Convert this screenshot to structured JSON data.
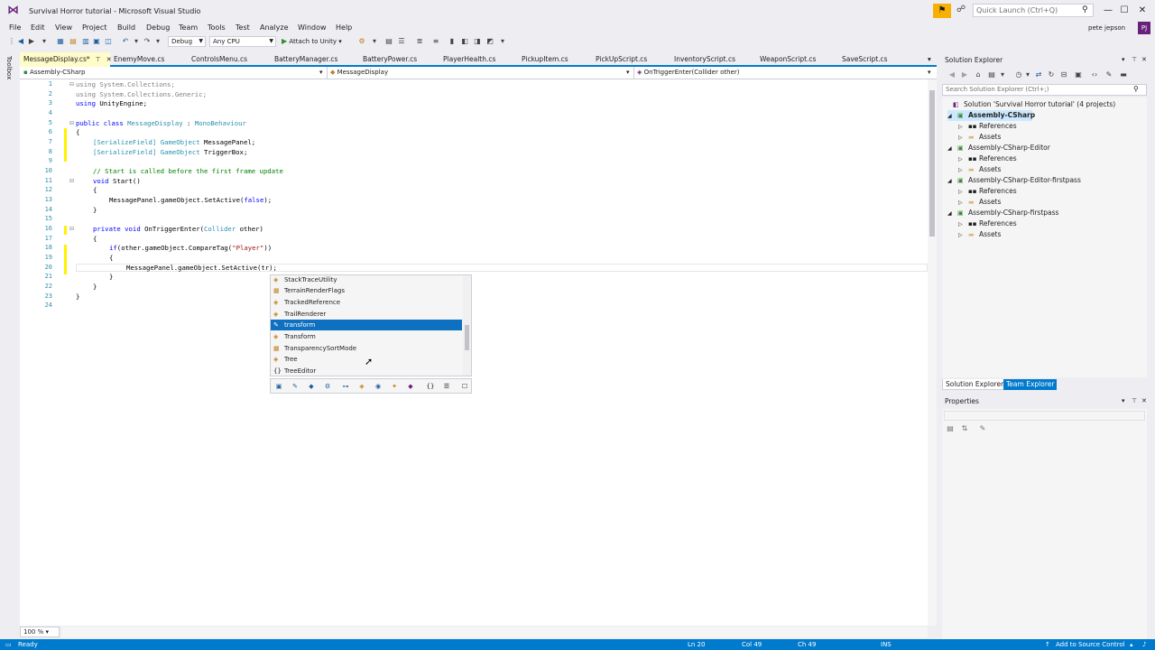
{
  "window": {
    "title": "Survival Horror tutorial - Microsoft Visual Studio",
    "quick_launch_placeholder": "Quick Launch (Ctrl+Q)",
    "user_name": "pete jepson",
    "user_initials": "PJ"
  },
  "menu": [
    "File",
    "Edit",
    "View",
    "Project",
    "Build",
    "Debug",
    "Team",
    "Tools",
    "Test",
    "Analyze",
    "Window",
    "Help"
  ],
  "toolbar": {
    "config": "Debug",
    "platform": "Any CPU",
    "attach": "Attach to Unity"
  },
  "toolbox_label": "Toolbox",
  "tabs": [
    {
      "label": "MessageDisplay.cs*",
      "active": true
    },
    {
      "label": "EnemyMove.cs"
    },
    {
      "label": "ControlsMenu.cs"
    },
    {
      "label": "BatteryManager.cs"
    },
    {
      "label": "BatteryPower.cs"
    },
    {
      "label": "PlayerHealth.cs"
    },
    {
      "label": "PickupItem.cs"
    },
    {
      "label": "PickUpScript.cs"
    },
    {
      "label": "InventoryScript.cs"
    },
    {
      "label": "WeaponScript.cs"
    },
    {
      "label": "SaveScript.cs"
    }
  ],
  "navbar": {
    "project": "Assembly-CSharp",
    "class": "MessageDisplay",
    "member": "OnTriggerEnter(Collider other)"
  },
  "code": {
    "line_numbers": [
      "1",
      "2",
      "3",
      "4",
      "5",
      "6",
      "7",
      "8",
      "9",
      "10",
      "11",
      "12",
      "13",
      "14",
      "15",
      "16",
      "17",
      "18",
      "19",
      "20",
      "21",
      "22",
      "23",
      "24"
    ],
    "using1": "using System.Collections;",
    "using2": "using System.Collections.Generic;",
    "using3_kw": "using",
    "using3_ns": " UnityEngine;",
    "class_kw": "public class ",
    "class_name": "MessageDisplay",
    "class_colon": " : ",
    "class_base": "MonoBehaviour",
    "brace_open": "{",
    "brace_close": "}",
    "sf1_attr": "[SerializeField]",
    "sf1_type": " GameObject",
    "sf1_name": " MessagePanel;",
    "sf2_attr": "[SerializeField]",
    "sf2_type": " GameObject",
    "sf2_name": " TriggerBox;",
    "comment": "// Start is called before the first frame update",
    "start_kw": "void",
    "start_name": " Start()",
    "start_open": "{",
    "start_body": "MessagePanel.gameObject.SetActive(",
    "start_false": "false",
    "start_end": ");",
    "start_close": "}",
    "ote_kw": "private void",
    "ote_name": " OnTriggerEnter(",
    "ote_type": "Collider",
    "ote_param": " other)",
    "ote_open": "{",
    "if_kw": "if",
    "if_body": "(other.gameObject.CompareTag(",
    "if_str": "\"Player\"",
    "if_end": "))",
    "if_open": "{",
    "set_body": "MessagePanel.gameObject.SetActive(tr);",
    "if_close": "}",
    "ote_close": "}",
    "class_close": "}"
  },
  "zoom": "100 %",
  "intellisense": {
    "items": [
      {
        "label": "StackTraceUtility",
        "icon": "class-icon"
      },
      {
        "label": "TerrainRenderFlags",
        "icon": "enum-icon"
      },
      {
        "label": "TrackedReference",
        "icon": "class-icon"
      },
      {
        "label": "TrailRenderer",
        "icon": "class-icon"
      },
      {
        "label": "transform",
        "icon": "property-icon",
        "selected": true
      },
      {
        "label": "Transform",
        "icon": "class-icon"
      },
      {
        "label": "TransparencySortMode",
        "icon": "enum-icon"
      },
      {
        "label": "Tree",
        "icon": "class-icon"
      },
      {
        "label": "TreeEditor",
        "icon": "namespace-icon"
      }
    ]
  },
  "solution_explorer": {
    "title": "Solution Explorer",
    "search_placeholder": "Search Solution Explorer (Ctrl+;)",
    "tree": [
      {
        "label": "Solution 'Survival Horror tutorial' (4 projects)",
        "depth": 0,
        "kind": "solution"
      },
      {
        "label": "Assembly-CSharp",
        "depth": 1,
        "kind": "project",
        "selected": true,
        "expanded": true
      },
      {
        "label": "References",
        "depth": 2,
        "kind": "references"
      },
      {
        "label": "Assets",
        "depth": 2,
        "kind": "folder"
      },
      {
        "label": "Assembly-CSharp-Editor",
        "depth": 1,
        "kind": "project",
        "expanded": true
      },
      {
        "label": "References",
        "depth": 2,
        "kind": "references"
      },
      {
        "label": "Assets",
        "depth": 2,
        "kind": "folder"
      },
      {
        "label": "Assembly-CSharp-Editor-firstpass",
        "depth": 1,
        "kind": "project",
        "expanded": true
      },
      {
        "label": "References",
        "depth": 2,
        "kind": "references"
      },
      {
        "label": "Assets",
        "depth": 2,
        "kind": "folder"
      },
      {
        "label": "Assembly-CSharp-firstpass",
        "depth": 1,
        "kind": "project",
        "expanded": true
      },
      {
        "label": "References",
        "depth": 2,
        "kind": "references"
      },
      {
        "label": "Assets",
        "depth": 2,
        "kind": "folder"
      }
    ],
    "tab_solution": "Solution Explorer",
    "tab_team": "Team Explorer"
  },
  "properties": {
    "title": "Properties"
  },
  "statusbar": {
    "ready": "Ready",
    "ln": "Ln 20",
    "col": "Col 49",
    "ch": "Ch 49",
    "ins": "INS",
    "source_control": "Add to Source Control"
  },
  "colors": {
    "accent": "#007acc",
    "vs_purple": "#68217a",
    "selection": "#0e70c0"
  }
}
